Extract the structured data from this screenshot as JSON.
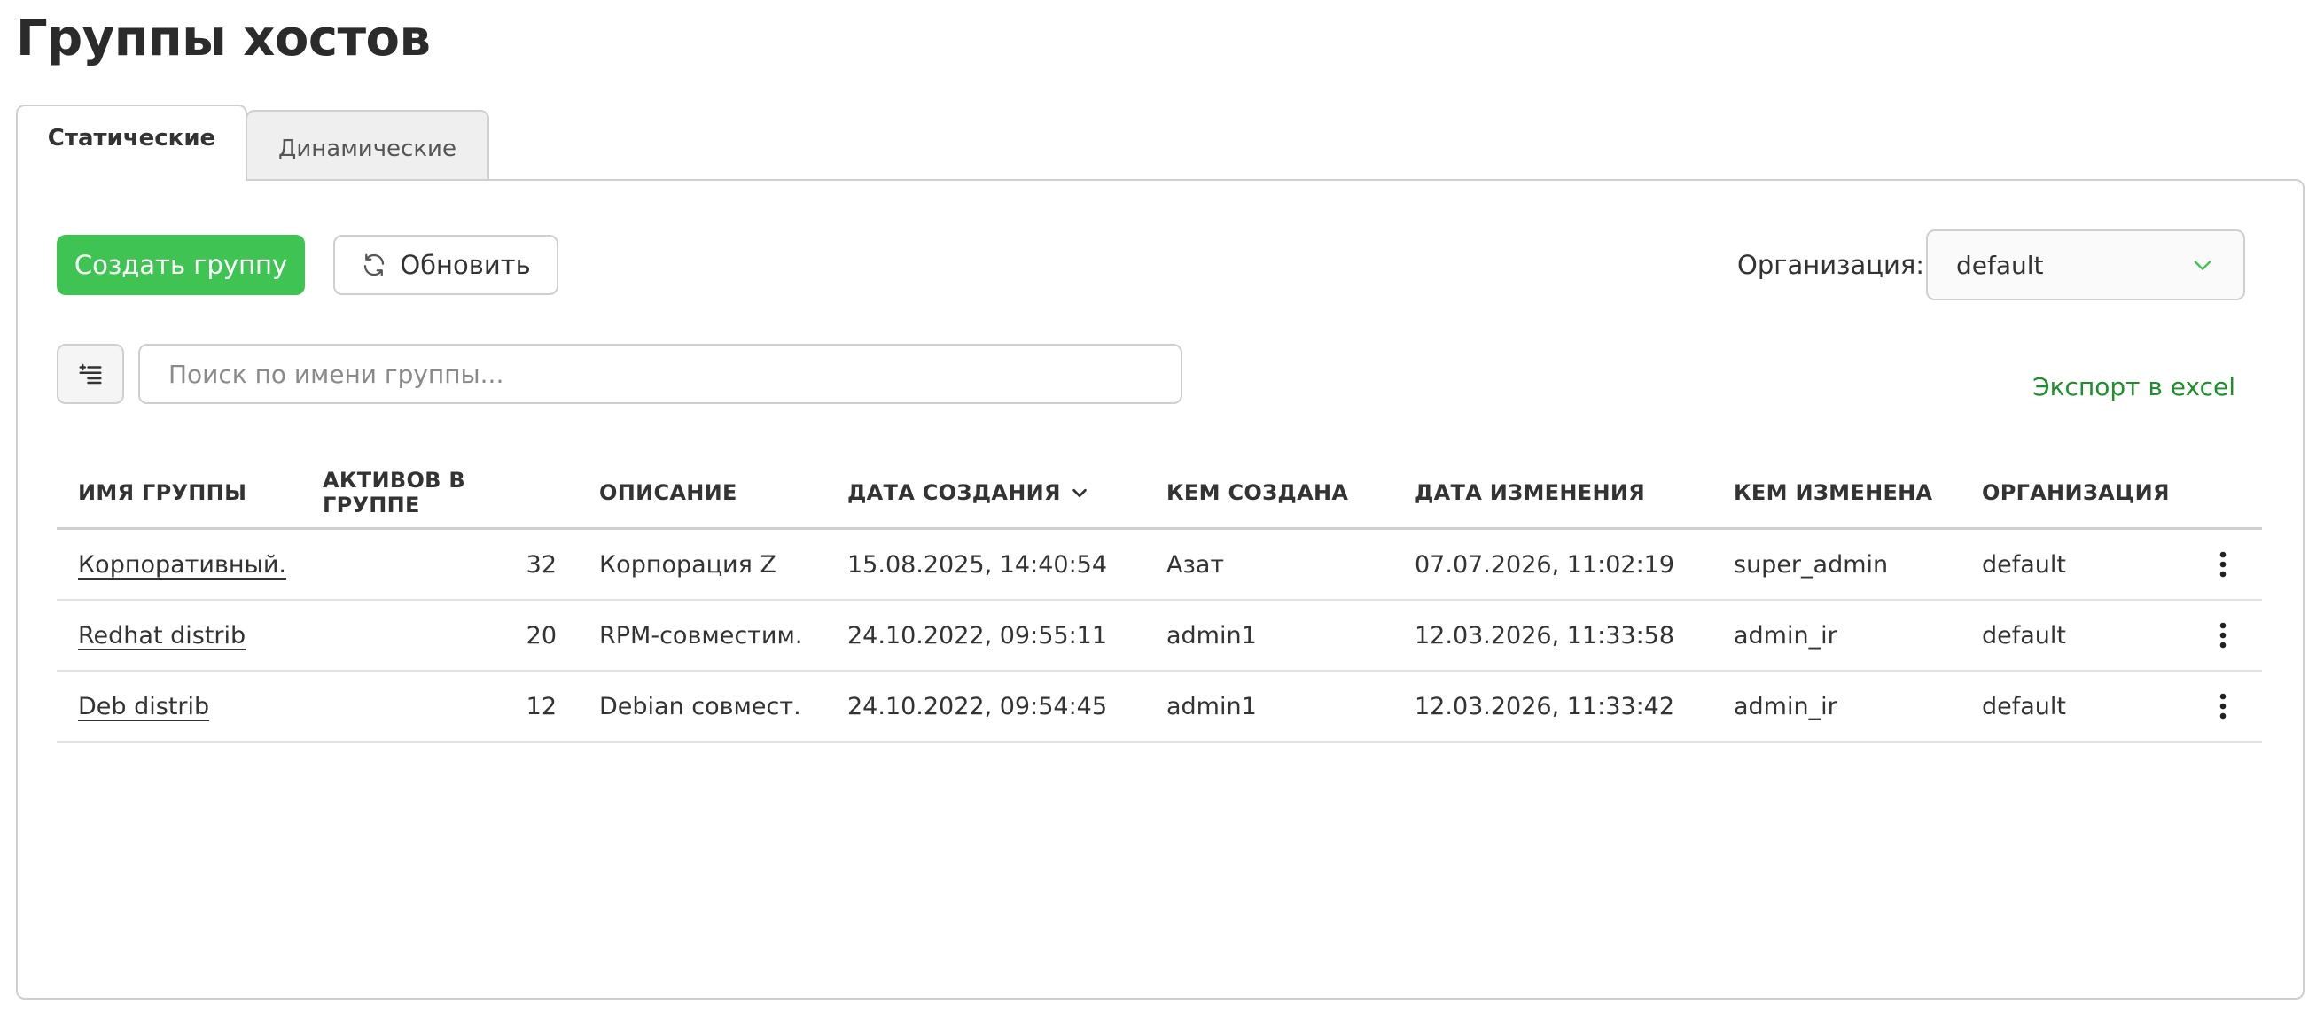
{
  "page": {
    "title": "Группы хостов"
  },
  "tabs": [
    {
      "label": "Статические",
      "active": true
    },
    {
      "label": "Динамические",
      "active": false
    }
  ],
  "toolbar": {
    "create_label": "Создать группу",
    "refresh_label": "Обновить",
    "org_label": "Организация:",
    "org_value": "default",
    "search_placeholder": "Поиск по имени группы...",
    "export_label": "Экспорт в excel"
  },
  "table": {
    "columns": [
      {
        "label": "ИМЯ ГРУППЫ"
      },
      {
        "label": "АКТИВОВ В ГРУППЕ"
      },
      {
        "label": "ОПИСАНИЕ"
      },
      {
        "label": "ДАТА СОЗДАНИЯ",
        "sorted": "desc"
      },
      {
        "label": "КЕМ СОЗДАНА"
      },
      {
        "label": "ДАТА ИЗМЕНЕНИЯ"
      },
      {
        "label": "КЕМ ИЗМЕНЕНА"
      },
      {
        "label": "ОРГАНИЗАЦИЯ"
      }
    ],
    "rows": [
      {
        "name": "Корпоративный...",
        "assets": "32",
        "description": "Корпорация Z",
        "created": "15.08.2025, 14:40:54",
        "created_by": "Азат",
        "modified": "07.07.2026, 11:02:19",
        "modified_by": "super_admin",
        "org": "default"
      },
      {
        "name": "Redhat distrib",
        "assets": "20",
        "description": "RPM-совместим...",
        "created": "24.10.2022, 09:55:11",
        "created_by": "admin1",
        "modified": "12.03.2026, 11:33:58",
        "modified_by": "admin_ir",
        "org": "default"
      },
      {
        "name": "Deb distrib",
        "assets": "12",
        "description": "Debian совмест...",
        "created": "24.10.2022, 09:54:45",
        "created_by": "admin1",
        "modified": "12.03.2026, 11:33:42",
        "modified_by": "admin_ir",
        "org": "default"
      }
    ]
  },
  "icons": {
    "refresh": "refresh-icon",
    "dropdown": "chevron-down-icon",
    "filter": "filter-list-icon",
    "sort": "chevron-down-icon",
    "row_menu": "kebab-menu-icon"
  },
  "colors": {
    "accent": "#3fc453",
    "link": "#1f8f2e",
    "border": "#cfcfcf"
  }
}
